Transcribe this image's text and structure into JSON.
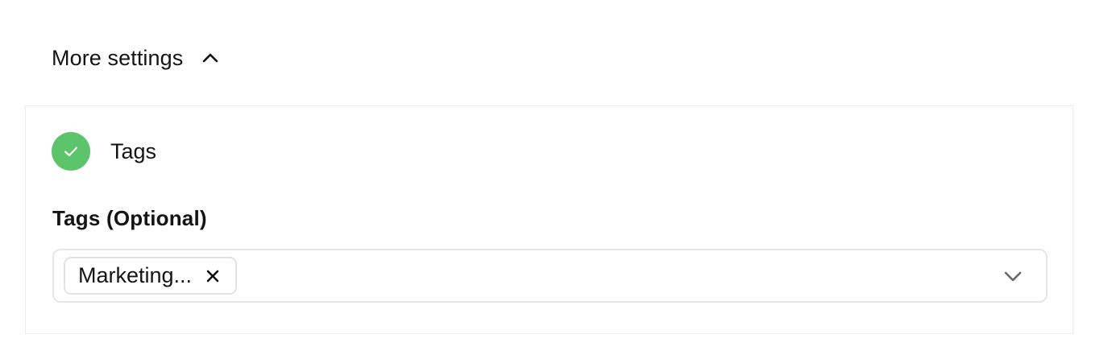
{
  "more_settings": {
    "label": "More settings",
    "expanded": true,
    "icon": "chevron-up-icon"
  },
  "tags_section": {
    "title": "Tags",
    "status_icon": "check-circle-icon",
    "status_color": "#5cc46a",
    "field_label": "Tags (Optional)",
    "selected_tags": [
      {
        "label": "Marketing...",
        "remove_icon": "close-icon"
      }
    ],
    "dropdown_icon": "chevron-down-icon"
  }
}
